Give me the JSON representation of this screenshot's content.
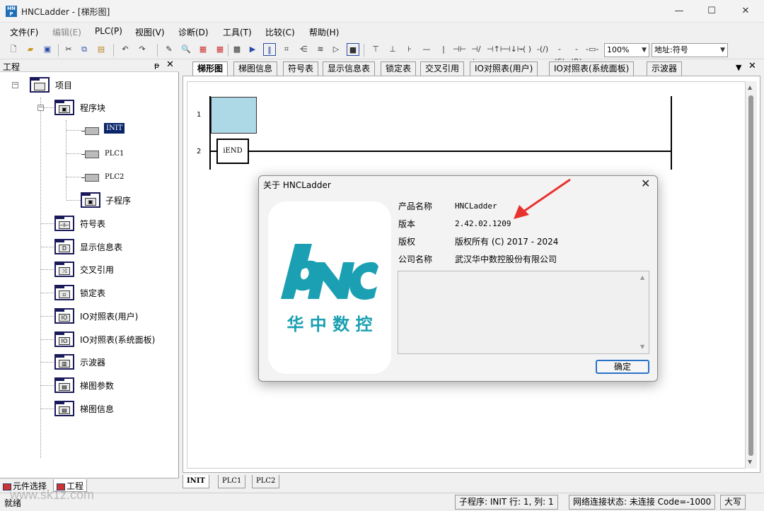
{
  "window": {
    "title": "HNCLadder - [梯形图]",
    "app_icon_text": "HN\nP",
    "minimize": "—",
    "maximize": "☐",
    "close": "✕"
  },
  "menu": {
    "items": [
      "文件(F)",
      "编辑(E)",
      "PLC(P)",
      "视图(V)",
      "诊断(D)",
      "工具(T)",
      "比较(C)",
      "帮助(H)"
    ]
  },
  "toolbar": {
    "zoom": "100%",
    "address_mode": "地址:符号"
  },
  "left_pane": {
    "title": "工程",
    "pin": "ᵽ",
    "close": "✕",
    "tree": {
      "root": "项目",
      "program_block": "程序块",
      "init": "INIT",
      "plc1": "PLC1",
      "plc2": "PLC2",
      "subroutine": "子程序",
      "symbol_table": "符号表",
      "display_info_table": "显示信息表",
      "cross_reference": "交叉引用",
      "lock_table": "锁定表",
      "io_user": "IO对照表(用户)",
      "io_panel": "IO对照表(系统面板)",
      "oscilloscope": "示波器",
      "ladder_params": "梯图参数",
      "ladder_info": "梯图信息"
    },
    "bottom_tabs": [
      "元件选择",
      "工程"
    ]
  },
  "main_tabs": [
    "梯形图",
    "梯图信息",
    "符号表",
    "显示信息表",
    "锁定表",
    "交叉引用",
    "IO对照表(用户)",
    "IO对照表(系统面板)",
    "示波器"
  ],
  "ladder": {
    "row1": "1",
    "row2": "2",
    "end_instruction": "iEND"
  },
  "sheet_tabs": [
    "INIT",
    "PLC1",
    "PLC2"
  ],
  "status": {
    "ready": "就绪",
    "position": "子程序: INIT  行: 1,  列: 1",
    "network": "网络连接状态: 未连接  Code=-1000",
    "caps": "大写",
    "watermark": "www.sk1z.com"
  },
  "dialog": {
    "title": "关于 HNCLadder",
    "close": "✕",
    "labels": {
      "product": "产品名称",
      "version": "版本",
      "copyright": "版权",
      "company": "公司名称"
    },
    "values": {
      "product": "HNCLadder",
      "version": "2.42.02.1209",
      "copyright": "版权所有 (C) 2017 - 2024",
      "company": "武汉华中数控股份有限公司"
    },
    "logo_text": "华 中 数 控",
    "ok": "确定",
    "logo_color": "#1aa0b2",
    "arrow_color": "#e8322f"
  }
}
